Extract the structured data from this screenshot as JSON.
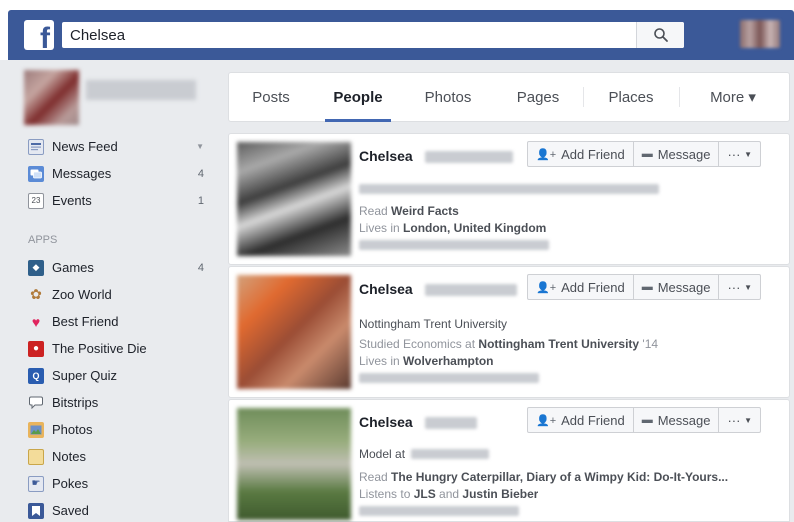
{
  "search": {
    "value": "Chelsea"
  },
  "sidebar": {
    "items": [
      {
        "label": "News Feed",
        "count": "",
        "icon": "news-feed-icon",
        "color": "#4e6ba6"
      },
      {
        "label": "Messages",
        "count": "4",
        "icon": "messages-icon",
        "color": "#5b8bd6"
      },
      {
        "label": "Events",
        "count": "1",
        "icon": "events-icon",
        "color": "#ffffff"
      }
    ],
    "apps_header": "APPS",
    "apps": [
      {
        "label": "Games",
        "count": "4",
        "icon": "games-icon",
        "color": "#2f5f8a"
      },
      {
        "label": "Zoo World",
        "count": "",
        "icon": "paw-icon",
        "color": "#b07a3a"
      },
      {
        "label": "Best Friend",
        "count": "",
        "icon": "heart-icon",
        "color": "#e0245e"
      },
      {
        "label": "The Positive Die",
        "count": "",
        "icon": "die-icon",
        "color": "#cc2222"
      },
      {
        "label": "Super Quiz",
        "count": "",
        "icon": "quiz-icon",
        "color": "#2a5db0"
      },
      {
        "label": "Bitstrips",
        "count": "",
        "icon": "speech-bubble-icon",
        "color": "#ffffff"
      },
      {
        "label": "Photos",
        "count": "",
        "icon": "photos-icon",
        "color": "#6b8fc7"
      },
      {
        "label": "Notes",
        "count": "",
        "icon": "notes-icon",
        "color": "#e8c060"
      },
      {
        "label": "Pokes",
        "count": "",
        "icon": "pokes-icon",
        "color": "#5b7fbf"
      },
      {
        "label": "Saved",
        "count": "",
        "icon": "saved-icon",
        "color": "#3b5998"
      }
    ]
  },
  "tabs": [
    "Posts",
    "People",
    "Photos",
    "Pages",
    "Places",
    "More ▾"
  ],
  "active_tab": "People",
  "buttons": {
    "add_friend": "Add Friend",
    "message": "Message",
    "more": "···"
  },
  "results": [
    {
      "name": "Chelsea",
      "line1_prefix": "",
      "line2_prefix": "Read ",
      "line2_bold": "Weird Facts",
      "line3_prefix": "Lives in ",
      "line3_bold": "London, United Kingdom"
    },
    {
      "name": "Chelsea",
      "line1_prefix": "Nottingham Trent University",
      "line2_prefix": "Studied Economics at ",
      "line2_bold": "Nottingham Trent University",
      "line2_suffix": " '14",
      "line3_prefix": "Lives in ",
      "line3_bold": "Wolverhampton"
    },
    {
      "name": "Chelsea",
      "line1_prefix": "Model at ",
      "line2_prefix": "Read ",
      "line2_bold": "The Hungry Caterpillar, Diary of a Wimpy Kid: Do-It-Yours...",
      "line3_prefix": "Listens to ",
      "line3_bold": "JLS",
      "line3_mid": " and ",
      "line3_bold2": "Justin Bieber"
    }
  ],
  "colors": {
    "brand": "#3b5998",
    "tab_underline": "#4267b2",
    "background": "#e9ebee"
  }
}
